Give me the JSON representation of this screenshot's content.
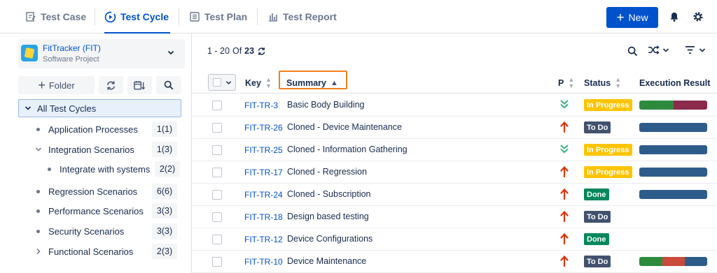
{
  "nav": {
    "tabs": [
      {
        "label": "Test Case",
        "icon": "edit-document-icon"
      },
      {
        "label": "Test Cycle",
        "icon": "play-circle-icon",
        "active": true
      },
      {
        "label": "Test Plan",
        "icon": "list-document-icon"
      },
      {
        "label": "Test Report",
        "icon": "bar-chart-icon"
      }
    ],
    "new_label": "New"
  },
  "project": {
    "name": "FitTracker (FIT)",
    "type": "Software Project"
  },
  "toolbar": {
    "folder_label": "Folder"
  },
  "tree": {
    "root": "All Test Cycles",
    "items": [
      {
        "label": "Application Processes",
        "count": "1(1)"
      },
      {
        "label": "Integration Scenarios",
        "count": "1(3)"
      },
      {
        "label": "Integrate with systems",
        "count": "2(2)"
      },
      {
        "label": "Regression Scenarios",
        "count": "6(6)"
      },
      {
        "label": "Performance Scenarios",
        "count": "3(3)"
      },
      {
        "label": "Security Scenarios",
        "count": "3(3)"
      },
      {
        "label": "Functional Scenarios",
        "count": "2(3)"
      }
    ]
  },
  "pager": {
    "range": "1 - 20",
    "of": "Of",
    "total": "23"
  },
  "columns": {
    "key": "Key",
    "summary": "Summary",
    "priority": "P",
    "status": "Status",
    "execution": "Execution Result"
  },
  "colors": {
    "accent": "#0052cc",
    "in_progress": "#ffc400",
    "todo": "#42526e",
    "done": "#00875a",
    "exec_blue": "#2e5c8a",
    "exec_green": "#2e8b3e",
    "exec_red": "#c94a3b",
    "exec_maroon": "#8b2a4a",
    "highlight": "#f07f1d"
  },
  "rows": [
    {
      "key": "FIT-TR-3",
      "summary": "Basic Body Building",
      "priority": "low",
      "status": "In Progress",
      "status_type": "in_progress",
      "exec": [
        {
          "c": "green",
          "w": 0.5
        },
        {
          "c": "maroon",
          "w": 0.5
        }
      ]
    },
    {
      "key": "FIT-TR-26",
      "summary": "Cloned - Device Maintenance",
      "priority": "high",
      "status": "To Do",
      "status_type": "todo",
      "exec": [
        {
          "c": "blue",
          "w": 1
        }
      ]
    },
    {
      "key": "FIT-TR-25",
      "summary": "Cloned - Information Gathering",
      "priority": "low",
      "status": "In Progress",
      "status_type": "in_progress",
      "exec": [
        {
          "c": "blue",
          "w": 1
        }
      ]
    },
    {
      "key": "FIT-TR-17",
      "summary": "Cloned - Regression",
      "priority": "high",
      "status": "In Progress",
      "status_type": "in_progress",
      "exec": [
        {
          "c": "blue",
          "w": 1
        }
      ]
    },
    {
      "key": "FIT-TR-24",
      "summary": "Cloned - Subscription",
      "priority": "high",
      "status": "Done",
      "status_type": "done",
      "exec": [
        {
          "c": "blue",
          "w": 1
        }
      ]
    },
    {
      "key": "FIT-TR-18",
      "summary": "Design based testing",
      "priority": "high",
      "status": "To Do",
      "status_type": "todo",
      "exec": []
    },
    {
      "key": "FIT-TR-12",
      "summary": "Device Configurations",
      "priority": "high",
      "status": "Done",
      "status_type": "done",
      "exec": []
    },
    {
      "key": "FIT-TR-10",
      "summary": "Device Maintenance",
      "priority": "high",
      "status": "To Do",
      "status_type": "todo",
      "exec": [
        {
          "c": "green",
          "w": 0.34
        },
        {
          "c": "red",
          "w": 0.33
        },
        {
          "c": "blue",
          "w": 0.33
        }
      ]
    }
  ]
}
